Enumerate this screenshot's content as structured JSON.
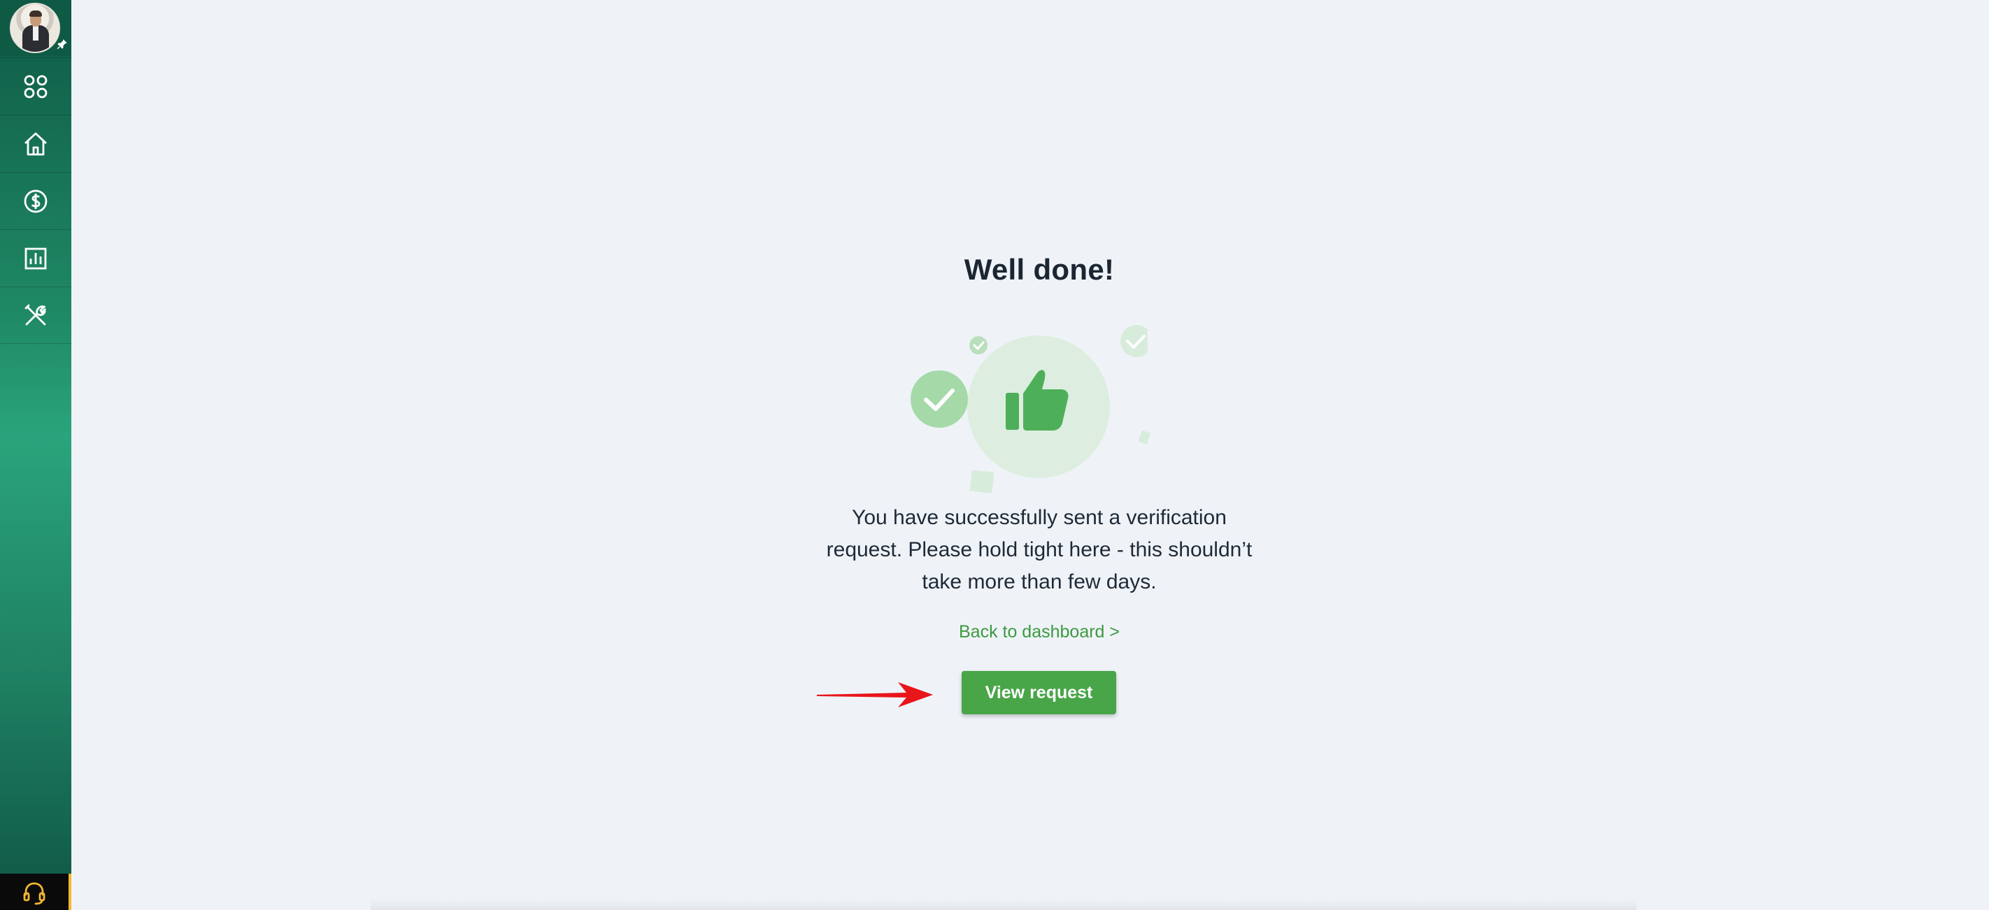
{
  "sidebar": {
    "items": [
      {
        "icon": "apps-grid-icon"
      },
      {
        "icon": "home-icon"
      },
      {
        "icon": "dollar-circle-icon"
      },
      {
        "icon": "bar-chart-icon"
      },
      {
        "icon": "tools-icon"
      }
    ],
    "support_icon": "headset-icon",
    "accent": "#f2b82e"
  },
  "main": {
    "title": "Well done!",
    "message_lines": [
      "You have successfully sent a verification",
      "request. Please hold tight here - this shouldn’t",
      "take more than few days."
    ],
    "back_link": "Back to dashboard >",
    "view_button": "View request",
    "colors": {
      "button": "#48a548",
      "link": "#3c9a3f",
      "annotation_arrow": "#e8151b"
    }
  }
}
